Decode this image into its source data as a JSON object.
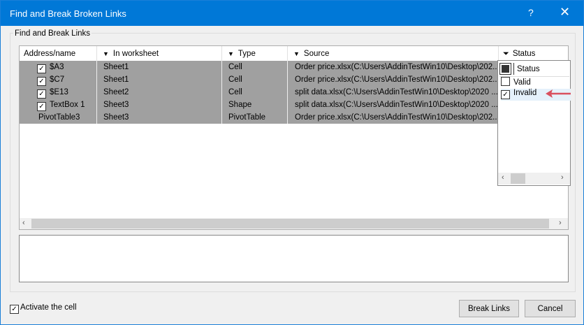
{
  "window": {
    "title": "Find and Break Broken Links",
    "help": "?",
    "close": "✕"
  },
  "group_label": "Find and Break Links",
  "columns": [
    "Address/name",
    "In worksheet",
    "Type",
    "Source",
    "Status"
  ],
  "rows": [
    {
      "checked": true,
      "address": "$A3",
      "worksheet": "Sheet1",
      "type": "Cell",
      "source": "Order price.xlsx(C:\\Users\\AddinTestWin10\\Desktop\\202..."
    },
    {
      "checked": true,
      "address": "$C7",
      "worksheet": "Sheet1",
      "type": "Cell",
      "source": "Order price.xlsx(C:\\Users\\AddinTestWin10\\Desktop\\202..."
    },
    {
      "checked": true,
      "address": "$E13",
      "worksheet": "Sheet2",
      "type": "Cell",
      "source": "split data.xlsx(C:\\Users\\AddinTestWin10\\Desktop\\2020 ..."
    },
    {
      "checked": true,
      "address": "TextBox 1",
      "worksheet": "Sheet3",
      "type": "Shape",
      "source": "split data.xlsx(C:\\Users\\AddinTestWin10\\Desktop\\2020 ..."
    },
    {
      "checked": false,
      "address": "PivotTable3",
      "worksheet": "Sheet3",
      "type": "PivotTable",
      "source": "Order price.xlsx(C:\\Users\\AddinTestWin10\\Desktop\\202..."
    }
  ],
  "filter": {
    "header": "Status",
    "options": [
      {
        "label": "Valid",
        "checked": false
      },
      {
        "label": "Invalid",
        "checked": true
      }
    ]
  },
  "activate_label": "Activate the cell",
  "activate_checked": true,
  "buttons": {
    "break": "Break Links",
    "cancel": "Cancel"
  },
  "colors": {
    "title_bar": "#0078d7",
    "selected_row": "#a0a0a0",
    "arrow": "#d9505f"
  }
}
